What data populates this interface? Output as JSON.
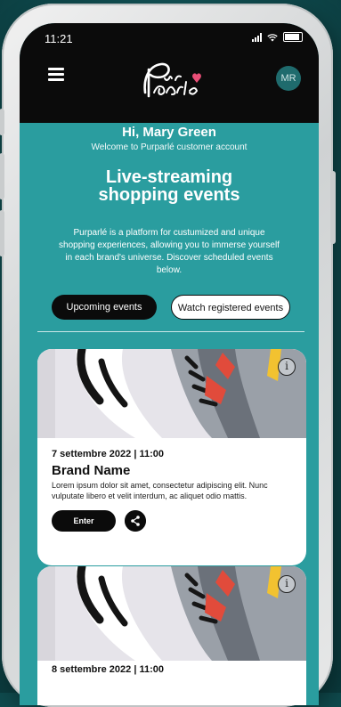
{
  "status_bar": {
    "time": "11:21"
  },
  "app_bar": {
    "logo_text_top": "Pur",
    "logo_text_bottom": "parlé",
    "avatar_initials": "MR"
  },
  "hero": {
    "greeting": "Hi, Mary Green",
    "welcome": "Welcome to Purparlé customer account",
    "title": "Live-streaming shopping events",
    "description": "Purparlé is a platform for custumized and unique shopping experiences, allowing you to immerse yourself in each brand's universe. Discover scheduled events below."
  },
  "tabs": [
    {
      "label": "Upcoming events",
      "selected": true
    },
    {
      "label": "Watch registered events",
      "selected": false
    }
  ],
  "events": [
    {
      "date": "7 settembre 2022 | 11:00",
      "brand": "Brand Name",
      "description": "Lorem ipsum dolor sit amet, consectetur adipiscing elit. Nunc vulputate libero et velit interdum, ac aliquet odio mattis.",
      "enter_label": "Enter",
      "info_icon": "info-icon",
      "share_icon": "share-icon"
    },
    {
      "date": "8 settembre 2022 | 11:00",
      "info_icon": "info-icon"
    }
  ],
  "colors": {
    "teal": "#2a9d9f",
    "dark": "#0b0b0b",
    "accent_pink": "#e94e77"
  }
}
